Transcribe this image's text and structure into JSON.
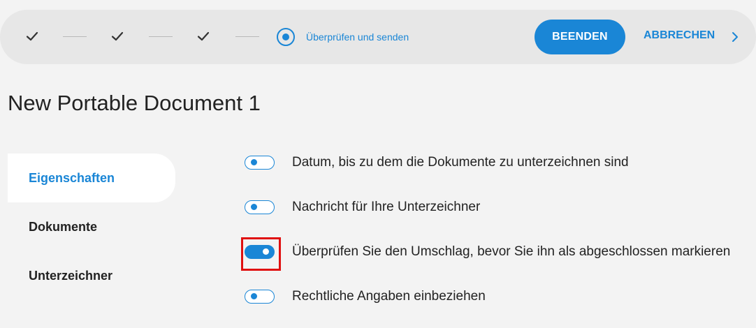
{
  "stepper": {
    "completed_steps": [
      {
        "icon": "check-icon"
      },
      {
        "icon": "check-icon"
      },
      {
        "icon": "check-icon"
      }
    ],
    "current_step_label": "Überprüfen und senden",
    "finish_label": "BEENDEN",
    "cancel_label": "ABBRECHEN",
    "more_icon": "chevron-right-icon"
  },
  "document": {
    "title": "New Portable Document 1"
  },
  "sidebar": {
    "items": [
      {
        "label": "Eigenschaften",
        "active": true
      },
      {
        "label": "Dokumente",
        "active": false
      },
      {
        "label": "Unterzeichner",
        "active": false
      }
    ]
  },
  "options": [
    {
      "label": "Datum, bis zu dem die Dokumente zu unterzeichnen sind",
      "enabled": false
    },
    {
      "label": "Nachricht für Ihre Unterzeichner",
      "enabled": false
    },
    {
      "label": "Überprüfen Sie den Umschlag, bevor Sie ihn als abgeschlossen markieren",
      "enabled": true,
      "highlighted": true
    },
    {
      "label": "Rechtliche Angaben einbeziehen",
      "enabled": false
    }
  ],
  "colors": {
    "accent": "#1a86d6",
    "background": "#f3f3f3",
    "stepper_bg": "#e7e7e7",
    "highlight": "#e01010"
  }
}
